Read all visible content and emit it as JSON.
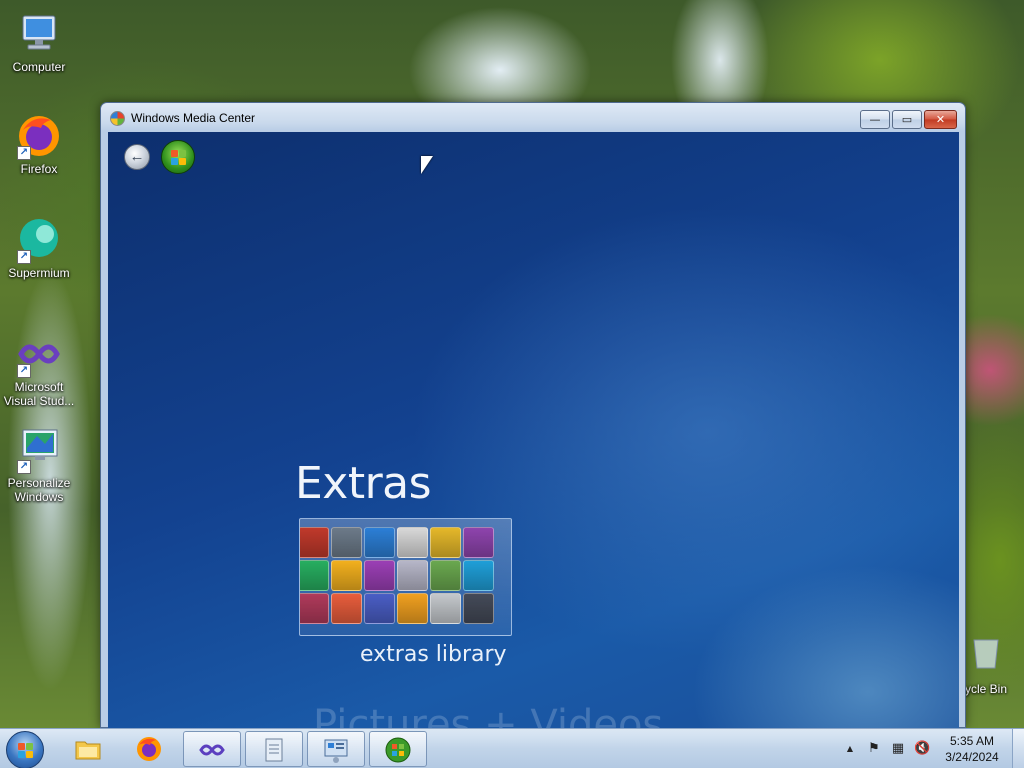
{
  "desktop": {
    "icons": [
      {
        "label": "Computer",
        "icon": "computer-icon"
      },
      {
        "label": "Firefox",
        "icon": "firefox-icon"
      },
      {
        "label": "Supermium",
        "icon": "supermium-icon"
      },
      {
        "label": "Microsoft Visual Stud...",
        "icon": "visual-studio-icon"
      },
      {
        "label": "Personalize Windows",
        "icon": "personalize-icon"
      },
      {
        "label": "ycle Bin",
        "icon": "recycle-bin-icon"
      }
    ]
  },
  "window": {
    "title": "Windows Media Center",
    "controls": {
      "minimize": "—",
      "maximize": "▭",
      "close": "✕"
    }
  },
  "media_center": {
    "back_button": "back-arrow-icon",
    "start_orb": "windows-logo-icon",
    "section_title": "Extras",
    "tile_label": "extras library",
    "next_row_label": "Pictures + Videos",
    "tile_colors": [
      "#c0392b",
      "#6c7a89",
      "#2c7fd6",
      "#d8d8d8",
      "#e5b82a",
      "#8e44ad",
      "#27ae60",
      "#f2b01e",
      "#9b3fb5",
      "#b6b6c8",
      "#6aa84f",
      "#1f9fd8",
      "#b03a5b",
      "#e85d3c",
      "#4a5ec5",
      "#f0a020",
      "#c4c8cc",
      "#444a58"
    ]
  },
  "taskbar": {
    "start": "windows-start-orb",
    "buttons": [
      {
        "name": "explorer",
        "icon": "folder-icon",
        "open": false
      },
      {
        "name": "firefox",
        "icon": "firefox-icon",
        "open": false
      },
      {
        "name": "visual-studio",
        "icon": "visual-studio-icon",
        "open": true
      },
      {
        "name": "notepad",
        "icon": "document-icon",
        "open": true
      },
      {
        "name": "control-panel",
        "icon": "control-panel-icon",
        "open": true
      },
      {
        "name": "media-center",
        "icon": "media-center-icon",
        "open": true
      }
    ],
    "tray": {
      "show_hidden": "▲",
      "flag": "⚑",
      "network": "▦",
      "volume": "🔇"
    },
    "clock": {
      "time": "5:35 AM",
      "date": "3/24/2024"
    }
  }
}
